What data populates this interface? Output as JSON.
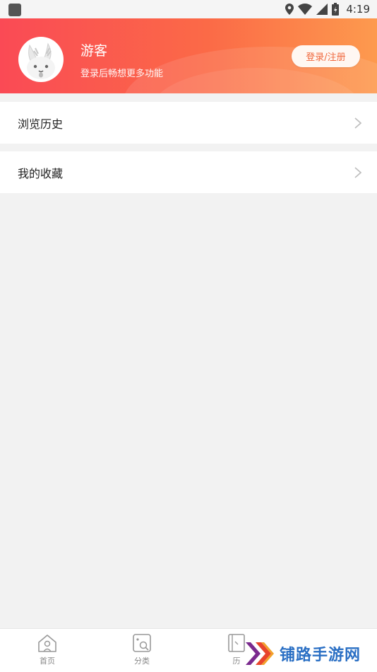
{
  "status_bar": {
    "time": "4:19",
    "icons": [
      "app-icon",
      "location-icon",
      "wifi-icon",
      "signal-icon",
      "battery-icon"
    ]
  },
  "header": {
    "user_name": "游客",
    "subtitle": "登录后畅想更多功能",
    "login_button": "登录/注册",
    "gradient_colors": [
      "#fa4a55",
      "#fd9a4e"
    ]
  },
  "menu": {
    "items": [
      {
        "label": "浏览历史",
        "icon": "chevron-right-icon"
      },
      {
        "label": "我的收藏",
        "icon": "chevron-right-icon"
      }
    ]
  },
  "bottom_nav": {
    "items": [
      {
        "label": "首页",
        "icon": "home-icon"
      },
      {
        "label": "分类",
        "icon": "category-icon"
      },
      {
        "label": "历",
        "icon": "history-icon"
      }
    ]
  },
  "watermark": {
    "text": "铺路手游网",
    "colors": [
      "#7a2a8e",
      "#e8452c",
      "#2a6fc4"
    ]
  }
}
